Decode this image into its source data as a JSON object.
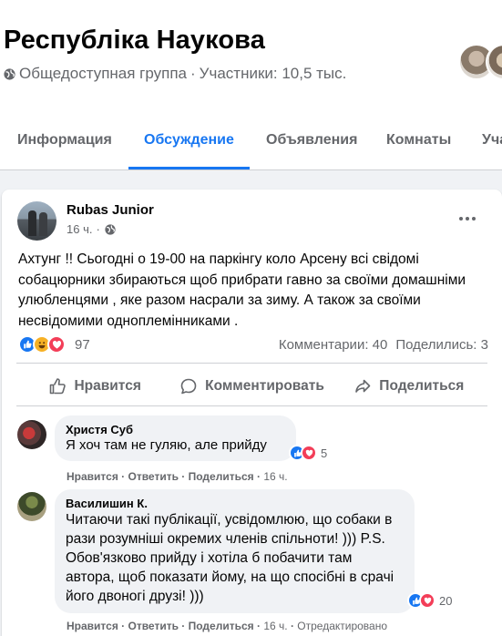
{
  "group": {
    "title": "Республіка Наукова",
    "privacy": "Общедоступная группа",
    "members": "Участники: 10,5 тыс."
  },
  "tabs": [
    "Информация",
    "Обсуждение",
    "Объявления",
    "Комнаты",
    "Уча"
  ],
  "post": {
    "author": "Rubas Junior",
    "time": "16 ч.",
    "text": "Ахтунг !!  Сьогодні о 19-00 на паркінгу коло Арсену всі свідомі собацюрники збираються щоб прибрати гавно за своїми домашніми улюбленцями , яке разом насрали за зиму. А також за своїми несвідомими одноплемінниками .",
    "reaction_count": "97",
    "comments_count": "Комментарии: 40",
    "shares_count": "Поделились: 3",
    "actions": {
      "like": "Нравится",
      "comment": "Комментировать",
      "share": "Поделиться"
    }
  },
  "comments": [
    {
      "author": "Христя Суб",
      "text": "Я хоч там не гуляю, але прийду",
      "reactions": "5",
      "like": "Нравится",
      "reply": "Ответить",
      "share": "Поделиться",
      "time": "16 ч."
    },
    {
      "author": "Василишин К.",
      "text": "Читаючи такі публікації, усвідомлюю, що собаки в рази розумніші окремих членів спільноти! ))) P.S. Обов'язково прийду і хотіла б побачити там автора, щоб показати йому, на що спосібні в срачі його двоногі друзі! )))",
      "reactions": "20",
      "like": "Нравится",
      "reply": "Ответить",
      "share": "Поделиться",
      "time": "16 ч.",
      "edited": "Отредактировано"
    }
  ],
  "colors": {
    "accent": "#1877f2",
    "like": "#1877f2",
    "love": "#f33e58",
    "haha": "#f7b125",
    "secondary_text": "#65676b"
  },
  "icons": [
    "globe-icon",
    "more-icon",
    "like-icon",
    "comment-icon",
    "share-icon",
    "like-reaction-icon",
    "haha-reaction-icon",
    "love-reaction-icon"
  ]
}
